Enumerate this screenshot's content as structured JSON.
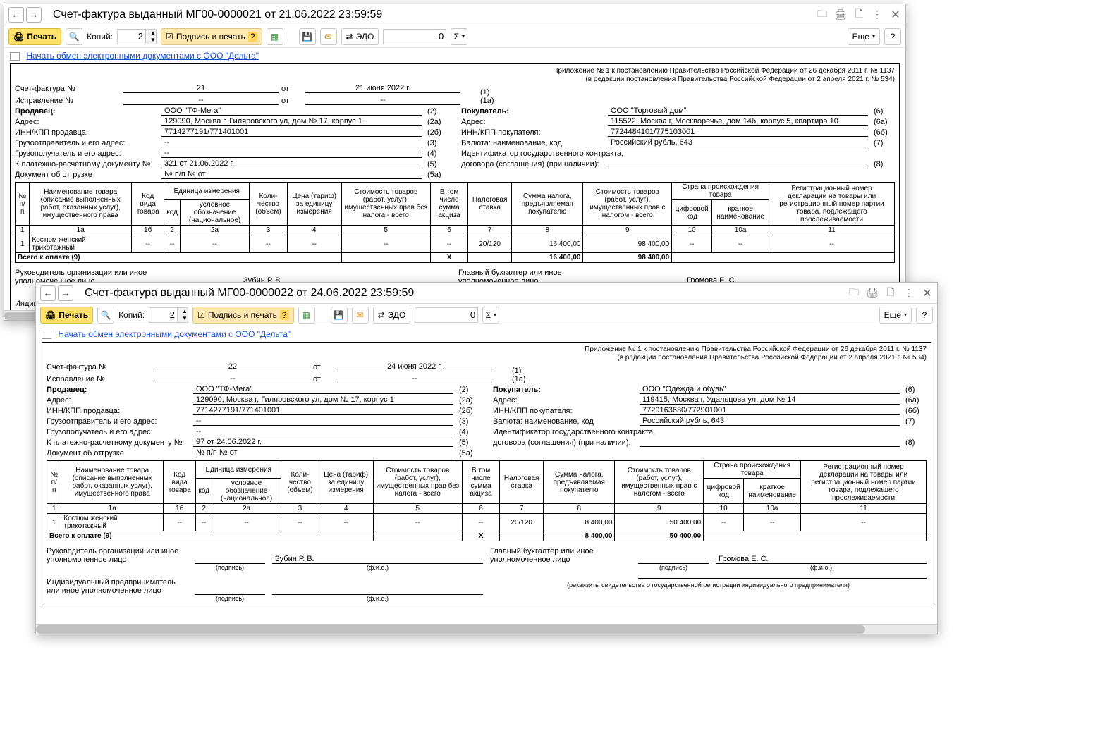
{
  "common": {
    "toolbar": {
      "back": "←",
      "fwd": "→",
      "print": "Печать",
      "magnifier": "🔍",
      "copies_label": "Копий:",
      "copies_value": "2",
      "sign": "Подпись и печать",
      "sign_q": "?",
      "save": "💾",
      "mail": "✉",
      "edo": "ЭДО",
      "num_value": "0",
      "sigma": "Σ",
      "more": "Еще",
      "help": "?"
    },
    "link_text": "Начать обмен электронными документами с ООО \"Дельта\"",
    "titlebar_icons": {
      "bookmark": "🗀",
      "print": "🖨",
      "preview": "🗋",
      "menu": "⋮",
      "close": "✕"
    },
    "legal1": "Приложение № 1 к постановлению Правительства Российской Федерации от 26 декабря 2011 г. № 1137",
    "legal2": "(в редакции постановления Правительства Российской Федерации от 2 апреля 2021 г. № 534)",
    "labels": {
      "sf_no": "Счет-фактура №",
      "corr_no": "Исправление №",
      "ot": "от",
      "seller": "Продавец:",
      "addr": "Адрес:",
      "inn": "ИНН/КПП продавца:",
      "consignor": "Грузоотправитель и его адрес:",
      "consignee": "Грузополучатель и его адрес:",
      "paydoc": "К платежно-расчетному документу №",
      "shipdoc": "Документ об отгрузке",
      "buyer": "Покупатель:",
      "buyer_addr": "Адрес:",
      "buyer_inn": "ИНН/КПП покупателя:",
      "currency": "Валюта: наименование, код",
      "contract1": "Идентификатор государственного контракта,",
      "contract2": "договора (соглашения) (при наличии):"
    },
    "line_codes": {
      "sf": "(1)",
      "corr": "(1а)",
      "seller": "(2)",
      "saddr": "(2а)",
      "sinn": "(2б)",
      "consignor": "(3)",
      "consignee": "(4)",
      "paydoc": "(5)",
      "shipdoc": "(5а)",
      "buyer": "(6)",
      "baddr": "(6а)",
      "binn": "(6б)",
      "currency": "(7)",
      "contract": "(8)"
    },
    "headers": {
      "num": "№ п/п",
      "name": "Наименование товара (описание выполненных работ, оказанных услуг), имущественного права",
      "kind": "Код вида товара",
      "unit": "Единица измерения",
      "unit_code": "код",
      "unit_name": "условное обозначение (национальное)",
      "qty": "Коли- чество (объем)",
      "price": "Цена (тариф) за единицу измерения",
      "cost_wo": "Стоимость товаров (работ, услуг), имущественных прав без налога - всего",
      "excise": "В том числе сумма акциза",
      "rate": "Налоговая ставка",
      "tax": "Сумма налога, предъявляемая покупателю",
      "cost_w": "Стоимость товаров (работ, услуг), имущественных прав с налогом - всего",
      "origin": "Страна происхождения товара",
      "origin_code": "цифровой код",
      "origin_name": "краткое наименование",
      "reg": "Регистрационный номер декларации на товары или регистрационный номер партии товара, подлежащего прослеживаемости"
    },
    "colnums": [
      "1",
      "1а",
      "1б",
      "2",
      "2а",
      "3",
      "4",
      "5",
      "6",
      "7",
      "8",
      "9",
      "10",
      "10а",
      "11"
    ],
    "total_label": "Всего к оплате (9)",
    "sig": {
      "mgr_role": "Руководитель организации или иное уполномоченное лицо",
      "acc_role": "Главный бухгалтер или иное уполномоченное лицо",
      "ip_role": "Индивидуальный предприниматель или иное уполномоченное лицо",
      "sign": "(подпись)",
      "fio": "(ф.и.о.)",
      "ip_note": "(реквизиты свидетельства о государственной регистрации индивидуального предпринимателя)"
    }
  },
  "docs": [
    {
      "title": "Счет-фактура выданный МГ00-0000021 от 21.06.2022 23:59:59",
      "sf_no": "21",
      "sf_date": "21 июня 2022 г.",
      "corr_no": "--",
      "corr_date": "--",
      "seller": "ООО \"ТФ-Мега\"",
      "seller_addr": "129090, Москва г, Гиляровского ул, дом № 17, корпус 1",
      "seller_inn": "7714277191/771401001",
      "consignor": "--",
      "consignee": "--",
      "paydoc": "321 от 21.06.2022 г.",
      "shipdoc": "№ п/п  №  от",
      "buyer": "ООО \"Торговый дом\"",
      "buyer_addr": "115522, Москва г, Москворечье, дом 14б, корпус 5, квартира 10",
      "buyer_inn": "7724484101/775103001",
      "currency": "Российский рубль, 643",
      "contract": "",
      "row": {
        "pp": "1",
        "name": "Костюм женский трикотажный",
        "kind": "--",
        "ucode": "--",
        "uname": "--",
        "qty": "--",
        "price": "--",
        "cost_wo": "--",
        "excise": "--",
        "rate": "20/120",
        "tax": "16 400,00",
        "cost_w": "98 400,00",
        "ocode": "--",
        "oname": "--",
        "reg": "--"
      },
      "total": {
        "tax": "16 400,00",
        "cost_w": "98 400,00"
      },
      "mgr_name": "Зубин Р. В.",
      "acc_name": "Громова Е. С."
    },
    {
      "title": "Счет-фактура выданный МГ00-0000022 от 24.06.2022 23:59:59",
      "sf_no": "22",
      "sf_date": "24 июня 2022 г.",
      "corr_no": "--",
      "corr_date": "--",
      "seller": "ООО \"ТФ-Мега\"",
      "seller_addr": "129090, Москва г, Гиляровского ул, дом № 17, корпус 1",
      "seller_inn": "7714277191/771401001",
      "consignor": "--",
      "consignee": "--",
      "paydoc": "97 от 24.06.2022 г.",
      "shipdoc": "№ п/п  №  от",
      "buyer": "ООО \"Одежда и обувь\"",
      "buyer_addr": "119415, Москва г, Удальцова ул, дом № 14",
      "buyer_inn": "7729163630/772901001",
      "currency": "Российский рубль, 643",
      "contract": "",
      "row": {
        "pp": "1",
        "name": "Костюм женский трикотажный",
        "kind": "--",
        "ucode": "--",
        "uname": "--",
        "qty": "--",
        "price": "--",
        "cost_wo": "--",
        "excise": "--",
        "rate": "20/120",
        "tax": "8 400,00",
        "cost_w": "50 400,00",
        "ocode": "--",
        "oname": "--",
        "reg": "--"
      },
      "total": {
        "tax": "8 400,00",
        "cost_w": "50 400,00"
      },
      "mgr_name": "Зубин Р. В.",
      "acc_name": "Громова Е. С."
    }
  ]
}
